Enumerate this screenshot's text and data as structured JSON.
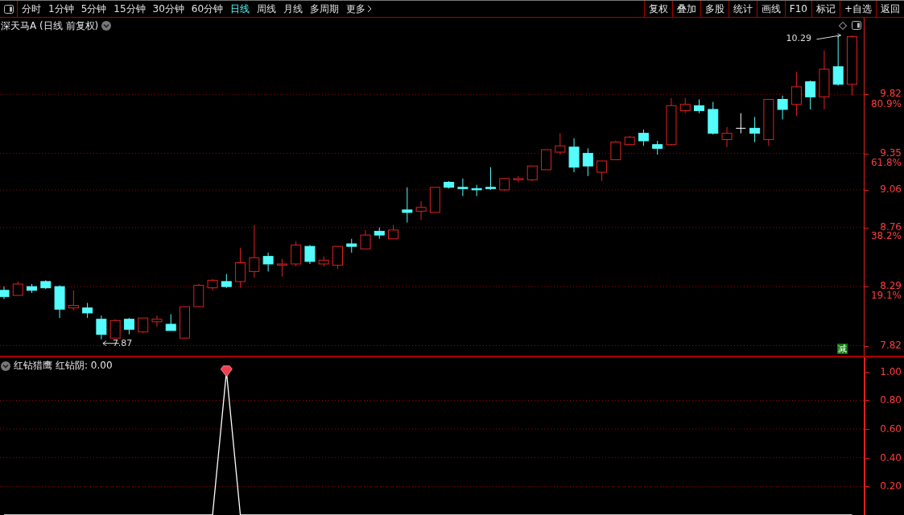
{
  "toolbar": {
    "periods": [
      {
        "label": "分时",
        "selected": false
      },
      {
        "label": "1分钟",
        "selected": false
      },
      {
        "label": "5分钟",
        "selected": false
      },
      {
        "label": "15分钟",
        "selected": false
      },
      {
        "label": "30分钟",
        "selected": false
      },
      {
        "label": "60分钟",
        "selected": false
      },
      {
        "label": "日线",
        "selected": true
      },
      {
        "label": "周线",
        "selected": false
      },
      {
        "label": "月线",
        "selected": false
      },
      {
        "label": "多周期",
        "selected": false
      },
      {
        "label": "更多",
        "selected": false
      }
    ],
    "actions": [
      "复权",
      "叠加",
      "多股",
      "统计",
      "画线",
      "F10",
      "标记",
      "+自选",
      "返回"
    ]
  },
  "price_pane": {
    "stock": "深天马A",
    "mode": "(日线 前复权)",
    "badge": "减",
    "high_label": "10.29",
    "low_label": "7.87",
    "fib_labels": [
      "80.9%",
      "61.8%",
      "38.2%",
      "19.1%"
    ],
    "chart_data": {
      "type": "candlestick",
      "ylim": [
        7.74,
        10.43
      ],
      "grid": true,
      "yticks": [
        {
          "value": 9.82,
          "label": "9.82"
        },
        {
          "value": 9.35,
          "label": "9.35"
        },
        {
          "value": 9.06,
          "label": "9.06"
        },
        {
          "value": 8.76,
          "label": "8.76"
        },
        {
          "value": 8.29,
          "label": "8.29"
        },
        {
          "value": 7.82,
          "label": "7.82"
        }
      ],
      "ohlc": [
        [
          8.26,
          8.29,
          8.19,
          8.21
        ],
        [
          8.22,
          8.33,
          8.22,
          8.31
        ],
        [
          8.29,
          8.31,
          8.24,
          8.26
        ],
        [
          8.33,
          8.34,
          8.27,
          8.28
        ],
        [
          8.29,
          8.3,
          8.04,
          8.11
        ],
        [
          8.12,
          8.26,
          8.1,
          8.14
        ],
        [
          8.12,
          8.16,
          8.04,
          8.08
        ],
        [
          8.03,
          8.06,
          7.87,
          7.91
        ],
        [
          7.88,
          8.03,
          7.88,
          8.02
        ],
        [
          8.03,
          8.04,
          7.91,
          7.95
        ],
        [
          7.93,
          8.04,
          7.92,
          8.04
        ],
        [
          8.01,
          8.06,
          7.97,
          8.03
        ],
        [
          7.99,
          8.07,
          7.94,
          7.94
        ],
        [
          7.88,
          8.13,
          7.88,
          8.13
        ],
        [
          8.13,
          8.31,
          8.13,
          8.3
        ],
        [
          8.28,
          8.35,
          8.26,
          8.34
        ],
        [
          8.33,
          8.39,
          8.28,
          8.29
        ],
        [
          8.33,
          8.6,
          8.28,
          8.48
        ],
        [
          8.41,
          8.78,
          8.36,
          8.52
        ],
        [
          8.53,
          8.56,
          8.41,
          8.47
        ],
        [
          8.46,
          8.51,
          8.37,
          8.47
        ],
        [
          8.47,
          8.65,
          8.45,
          8.62
        ],
        [
          8.61,
          8.62,
          8.47,
          8.49
        ],
        [
          8.47,
          8.53,
          8.45,
          8.5
        ],
        [
          8.46,
          8.61,
          8.43,
          8.61
        ],
        [
          8.63,
          8.67,
          8.56,
          8.61
        ],
        [
          8.59,
          8.74,
          8.59,
          8.7
        ],
        [
          8.73,
          8.76,
          8.67,
          8.7
        ],
        [
          8.67,
          8.78,
          8.67,
          8.74
        ],
        [
          8.9,
          9.08,
          8.8,
          8.88
        ],
        [
          8.89,
          8.97,
          8.82,
          8.92
        ],
        [
          8.88,
          9.08,
          8.88,
          9.08
        ],
        [
          9.12,
          9.13,
          9.07,
          9.08
        ],
        [
          9.08,
          9.15,
          9.01,
          9.07
        ],
        [
          9.07,
          9.1,
          9.01,
          9.06
        ],
        [
          9.08,
          9.24,
          9.06,
          9.07
        ],
        [
          9.06,
          9.15,
          9.05,
          9.15
        ],
        [
          9.14,
          9.17,
          9.12,
          9.15
        ],
        [
          9.14,
          9.25,
          9.13,
          9.25
        ],
        [
          9.22,
          9.38,
          9.22,
          9.38
        ],
        [
          9.36,
          9.51,
          9.34,
          9.41
        ],
        [
          9.4,
          9.47,
          9.2,
          9.24
        ],
        [
          9.35,
          9.39,
          9.17,
          9.25
        ],
        [
          9.2,
          9.29,
          9.13,
          9.29
        ],
        [
          9.3,
          9.45,
          9.3,
          9.44
        ],
        [
          9.42,
          9.49,
          9.42,
          9.48
        ],
        [
          9.51,
          9.54,
          9.41,
          9.45
        ],
        [
          9.42,
          9.45,
          9.34,
          9.39
        ],
        [
          9.42,
          9.79,
          9.41,
          9.73
        ],
        [
          9.69,
          9.79,
          9.67,
          9.74
        ],
        [
          9.73,
          9.78,
          9.67,
          9.69
        ],
        [
          9.7,
          9.76,
          9.5,
          9.51
        ],
        [
          9.46,
          9.56,
          9.4,
          9.51
        ],
        [
          9.55,
          9.67,
          9.51,
          9.55
        ],
        [
          9.55,
          9.64,
          9.44,
          9.51
        ],
        [
          9.46,
          9.78,
          9.41,
          9.78
        ],
        [
          9.78,
          9.81,
          9.62,
          9.7
        ],
        [
          9.74,
          10.0,
          9.65,
          9.88
        ],
        [
          9.92,
          9.93,
          9.7,
          9.8
        ],
        [
          9.8,
          10.17,
          9.7,
          10.02
        ],
        [
          10.04,
          10.28,
          9.89,
          9.9
        ],
        [
          9.9,
          10.29,
          9.81,
          10.28
        ]
      ]
    }
  },
  "indicator_pane": {
    "name": "红钻猎鹰",
    "reading": "红钻阴: 0.00",
    "chart_data": {
      "type": "line",
      "ylim": [
        0,
        1.1
      ],
      "grid": true,
      "yticks": [
        {
          "value": 1.0,
          "label": "1.00"
        },
        {
          "value": 0.8,
          "label": "0.80"
        },
        {
          "value": 0.6,
          "label": "0.60"
        },
        {
          "value": 0.4,
          "label": "0.40"
        },
        {
          "value": 0.2,
          "label": "0.20"
        }
      ],
      "series": [
        {
          "color": "#ffffff",
          "values": [
            0,
            0,
            0,
            0,
            0,
            0,
            0,
            0,
            0,
            0,
            0,
            0,
            0,
            0,
            0,
            0,
            1,
            0,
            0,
            0,
            0,
            0,
            0,
            0,
            0,
            0,
            0,
            0,
            0,
            0,
            0,
            0,
            0,
            0,
            0,
            0,
            0,
            0,
            0,
            0,
            0,
            0,
            0,
            0,
            0,
            0,
            0,
            0,
            0,
            0,
            0,
            0,
            0,
            0,
            0,
            0,
            0,
            0,
            0,
            0,
            0,
            0
          ]
        }
      ]
    }
  }
}
